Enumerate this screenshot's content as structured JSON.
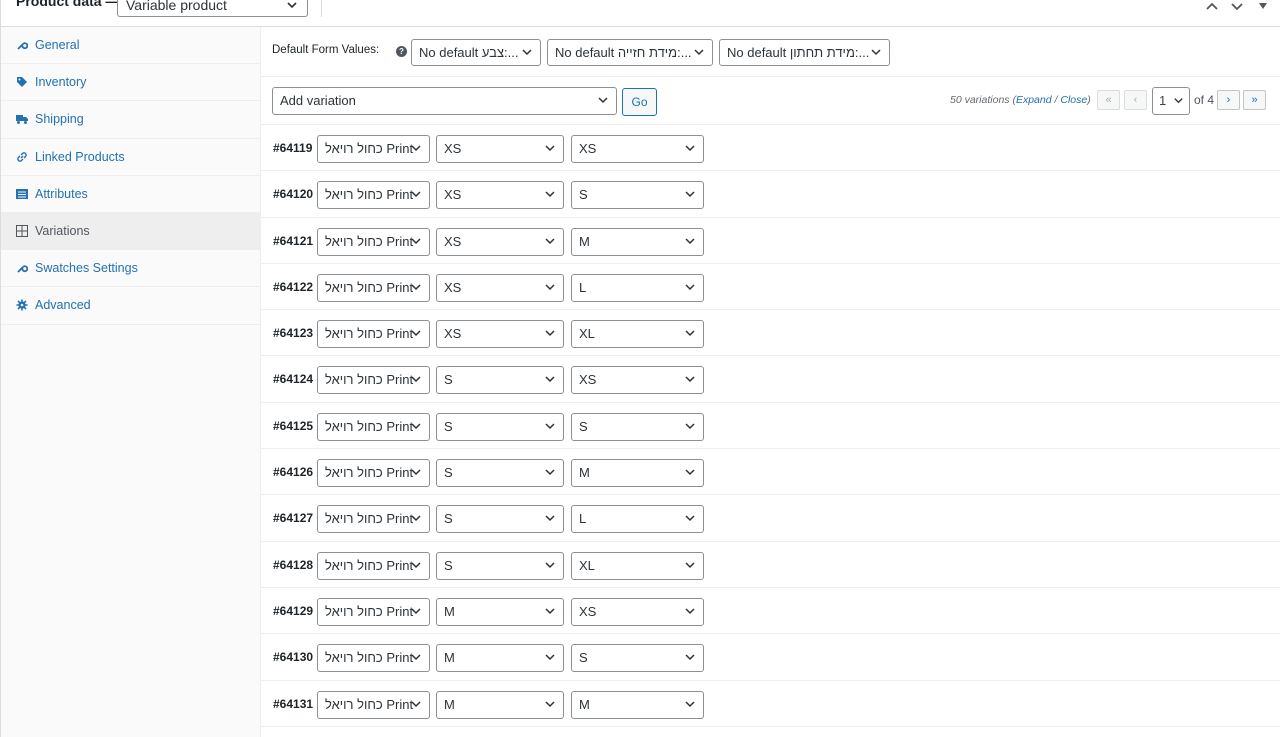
{
  "header": {
    "title": "Product data —",
    "product_type": "Variable product"
  },
  "sidebar": {
    "items": [
      {
        "label": "General",
        "icon": "wrench-icon"
      },
      {
        "label": "Inventory",
        "icon": "tag-icon"
      },
      {
        "label": "Shipping",
        "icon": "truck-icon"
      },
      {
        "label": "Linked Products",
        "icon": "link-icon"
      },
      {
        "label": "Attributes",
        "icon": "list-icon"
      },
      {
        "label": "Variations",
        "icon": "grid-icon",
        "active": true
      },
      {
        "label": "Swatches Settings",
        "icon": "wrench-icon"
      },
      {
        "label": "Advanced",
        "icon": "gear-icon"
      }
    ]
  },
  "default_form": {
    "label": "Default Form Values:",
    "selects": [
      "No default צבע:...",
      "No default מידת חזייה:...",
      "No default מידת תחתון:..."
    ]
  },
  "toolbar": {
    "add_variation": "Add variation",
    "go": "Go",
    "count_text": "50 variations",
    "expand": "Expand",
    "close": "Close",
    "first": "«",
    "prev": "‹",
    "page": "1",
    "of_pages": "of 4",
    "next": "›",
    "last": "»"
  },
  "variations": [
    {
      "id": "#64119",
      "color": "כחול רויאל Print",
      "bra": "XS",
      "bottom": "XS"
    },
    {
      "id": "#64120",
      "color": "כחול רויאל Print",
      "bra": "XS",
      "bottom": "S"
    },
    {
      "id": "#64121",
      "color": "כחול רויאל Print",
      "bra": "XS",
      "bottom": "M"
    },
    {
      "id": "#64122",
      "color": "כחול רויאל Print",
      "bra": "XS",
      "bottom": "L"
    },
    {
      "id": "#64123",
      "color": "כחול רויאל Print",
      "bra": "XS",
      "bottom": "XL"
    },
    {
      "id": "#64124",
      "color": "כחול רויאל Print",
      "bra": "S",
      "bottom": "XS"
    },
    {
      "id": "#64125",
      "color": "כחול רויאל Print",
      "bra": "S",
      "bottom": "S"
    },
    {
      "id": "#64126",
      "color": "כחול רויאל Print",
      "bra": "S",
      "bottom": "M"
    },
    {
      "id": "#64127",
      "color": "כחול רויאל Print",
      "bra": "S",
      "bottom": "L"
    },
    {
      "id": "#64128",
      "color": "כחול רויאל Print",
      "bra": "S",
      "bottom": "XL"
    },
    {
      "id": "#64129",
      "color": "כחול רויאל Print",
      "bra": "M",
      "bottom": "XS"
    },
    {
      "id": "#64130",
      "color": "כחול רויאל Print",
      "bra": "M",
      "bottom": "S"
    },
    {
      "id": "#64131",
      "color": "כחול רויאל Print",
      "bra": "M",
      "bottom": "M"
    }
  ],
  "colors": {
    "link": "#2271b1",
    "active_bg": "#eeeeee",
    "border": "#8c8f94"
  }
}
